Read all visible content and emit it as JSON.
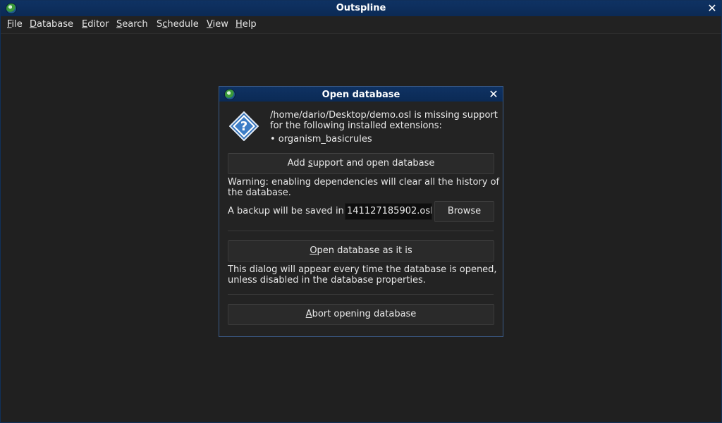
{
  "window": {
    "title": "Outspline",
    "close": "✕"
  },
  "menu": [
    {
      "mnemonic": "F",
      "rest": "ile"
    },
    {
      "mnemonic": "D",
      "rest": "atabase"
    },
    {
      "mnemonic": "E",
      "rest": "ditor"
    },
    {
      "mnemonic": "S",
      "rest": "earch"
    },
    {
      "pre": "S",
      "mnemonic": "c",
      "rest": "hedule"
    },
    {
      "mnemonic": "V",
      "rest": "iew"
    },
    {
      "mnemonic": "H",
      "rest": "elp"
    }
  ],
  "dialog": {
    "title": "Open database",
    "close": "✕",
    "message_line1": "/home/dario/Desktop/demo.osl is missing support",
    "message_line2": "for the following installed extensions:",
    "extension": "• organism_basicrules",
    "add_button": {
      "pre": "Add ",
      "mnemonic": "s",
      "rest": "upport and open database"
    },
    "warning_line1": "Warning: enabling dependencies will clear all the history of",
    "warning_line2": "the database.",
    "backup_label": "A backup will be saved in:",
    "backup_value": "141127185902.osl",
    "browse_label": "Browse",
    "open_button": {
      "pre": "",
      "mnemonic": "O",
      "rest": "pen database as it is"
    },
    "info_line1": "This dialog will appear every time the database is opened,",
    "info_line2": "unless disabled in the database properties.",
    "abort_button": {
      "pre": "",
      "mnemonic": "A",
      "rest": "bort opening database"
    }
  },
  "icons": {
    "app": "outspline-app-icon",
    "question": "question-icon"
  }
}
